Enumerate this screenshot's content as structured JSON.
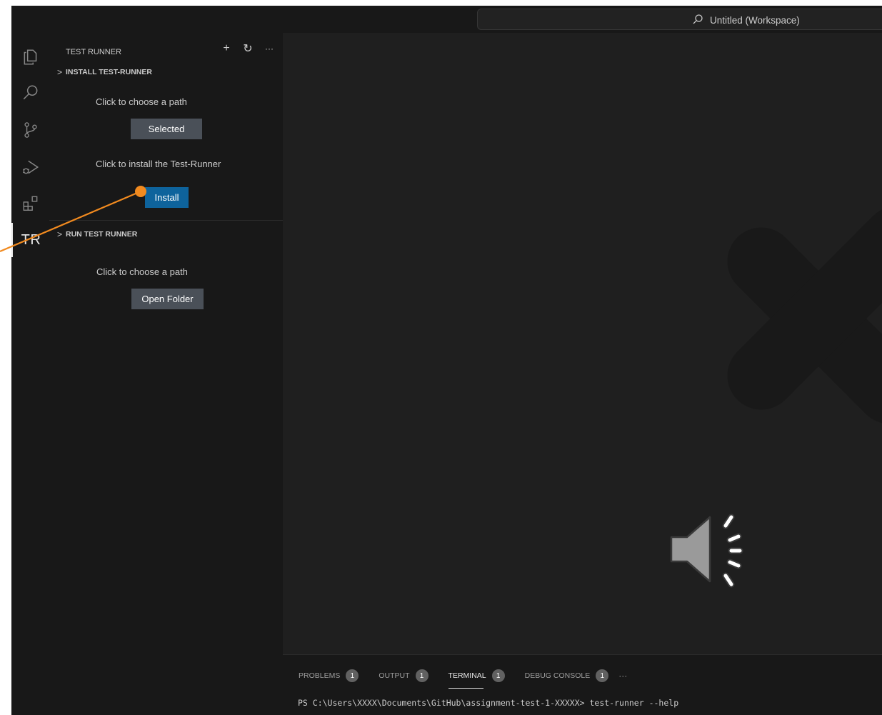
{
  "window": {
    "command_center": {
      "label": "Untitled (Workspace)",
      "icon": "search-icon"
    }
  },
  "activity_bar": {
    "items": [
      {
        "name": "explorer-icon"
      },
      {
        "name": "search-icon"
      },
      {
        "name": "source-control-icon"
      },
      {
        "name": "run-debug-icon"
      },
      {
        "name": "extensions-icon"
      },
      {
        "name": "test-runner-view",
        "label": "TR",
        "active": true
      }
    ]
  },
  "sidebar": {
    "title": "TEST RUNNER",
    "actions": [
      {
        "name": "add-icon",
        "glyph": "+"
      },
      {
        "name": "refresh-icon",
        "glyph": "↻"
      },
      {
        "name": "more-actions-icon",
        "glyph": "···"
      }
    ],
    "install_section": {
      "header": "INSTALL TEST-RUNNER",
      "choose_path_text": "Click to choose a path",
      "selected_button": "Selected",
      "install_text": "Click to install the Test-Runner",
      "install_button": "Install"
    },
    "run_section": {
      "header": "RUN TEST RUNNER",
      "choose_path_text": "Click to choose a path",
      "open_folder_button": "Open Folder"
    }
  },
  "panel": {
    "tabs": [
      {
        "label": "PROBLEMS",
        "badge": "1",
        "active": false
      },
      {
        "label": "OUTPUT",
        "badge": "1",
        "active": false
      },
      {
        "label": "TERMINAL",
        "badge": "1",
        "active": true
      },
      {
        "label": "DEBUG CONSOLE",
        "badge": "1",
        "active": false
      }
    ],
    "more": "···",
    "terminal_line": "PS C:\\Users\\XXXX\\Documents\\GitHub\\assignment-test-1-XXXXX> test-runner --help"
  },
  "colors": {
    "primary_button": "#0e639c",
    "secondary_button": "#4a5058",
    "annotation": "#f18a1f"
  }
}
